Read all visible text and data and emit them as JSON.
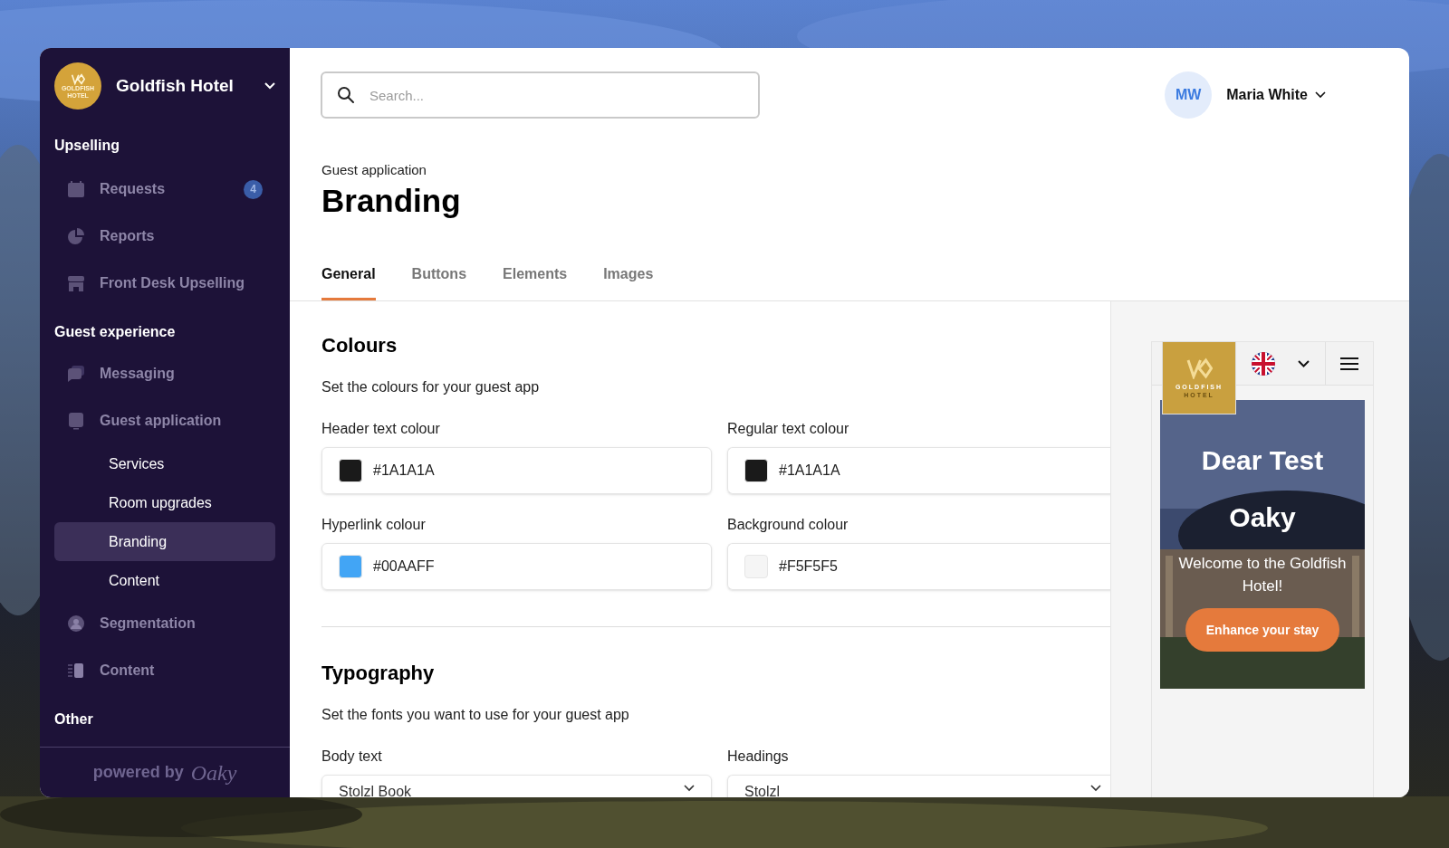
{
  "sidebar": {
    "hotel": "Goldfish Hotel",
    "logo_text": [
      "GOLDFISH",
      "HOTEL"
    ],
    "sections": [
      {
        "title": "Upselling",
        "items": [
          {
            "label": "Requests",
            "badge": "4",
            "selected": false
          },
          {
            "label": "Reports",
            "selected": false
          },
          {
            "label": "Front Desk Upselling",
            "selected": false
          }
        ]
      },
      {
        "title": "Guest experience",
        "items": [
          {
            "label": "Messaging",
            "selected": false
          },
          {
            "label": "Guest application",
            "selected": false,
            "children": [
              {
                "label": "Services",
                "selected": false
              },
              {
                "label": "Room upgrades",
                "selected": false
              },
              {
                "label": "Branding",
                "selected": true
              },
              {
                "label": "Content",
                "selected": false
              }
            ]
          },
          {
            "label": "Segmentation",
            "selected": false
          },
          {
            "label": "Content",
            "selected": false
          }
        ]
      },
      {
        "title": "Other"
      }
    ],
    "footer": "powered by",
    "footer_brand": "Oaky"
  },
  "search": {
    "placeholder": "Search..."
  },
  "user": {
    "initials": "MW",
    "name": "Maria White"
  },
  "page": {
    "breadcrumb": "Guest application",
    "title": "Branding"
  },
  "tabs": [
    {
      "label": "General",
      "selected": true
    },
    {
      "label": "Buttons",
      "selected": false
    },
    {
      "label": "Elements",
      "selected": false
    },
    {
      "label": "Images",
      "selected": false
    }
  ],
  "sections": [
    {
      "title": "Colours",
      "description": "Set the colours for your guest app",
      "fields": [
        {
          "kind": "color",
          "label": "Header text colour",
          "value": "#1A1A1A",
          "color": "#1a1a1a"
        },
        {
          "kind": "color",
          "label": "Regular text colour",
          "value": "#1A1A1A",
          "color": "#1a1a1a"
        },
        {
          "kind": "color",
          "label": "Hyperlink colour",
          "value": "#00AAFF",
          "color": "#42a5f5"
        },
        {
          "kind": "color",
          "label": "Background colour",
          "value": "#F5F5F5",
          "color": "#f5f5f5"
        }
      ]
    },
    {
      "title": "Typography",
      "description": "Set the fonts you want to use for your guest app",
      "fields": [
        {
          "kind": "select",
          "label": "Body text",
          "value": "Stolzl Book"
        },
        {
          "kind": "select",
          "label": "Headings",
          "value": "Stolzl"
        }
      ]
    }
  ],
  "preview": {
    "logo_text": [
      "GOLDFISH",
      "HOTEL"
    ],
    "greeting": "Dear Test",
    "name": "Oaky",
    "welcome": "Welcome to the Goldfish Hotel!",
    "button": "Enhance your stay"
  }
}
